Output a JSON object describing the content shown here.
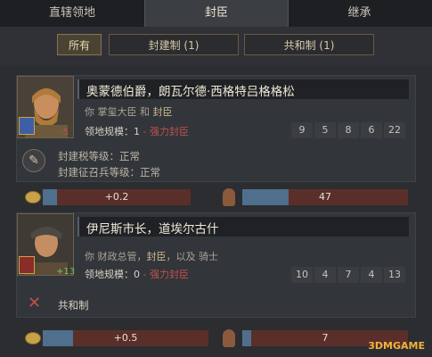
{
  "tabs": [
    {
      "label": "直辖领地"
    },
    {
      "label": "封臣"
    },
    {
      "label": "继承"
    }
  ],
  "filters": [
    {
      "label": "所有"
    },
    {
      "label": "封建制 (1)"
    },
    {
      "label": "共和制 (1)"
    }
  ],
  "vassals": [
    {
      "name": "奥蒙德伯爵，朗瓦尔德·西格特吕格格松",
      "opinion": "-5",
      "role_prefix": "你 掌玺大臣 和 ",
      "role_link": "封臣",
      "domain_label": "领地规模：",
      "domain_value": "1",
      "domain_note": "- 强力封臣",
      "stats": [
        "9",
        "5",
        "8",
        "6",
        "22"
      ],
      "tax_line": "封建税等级：正常",
      "levy_line": "封建征召兵等级：正常",
      "tax_value": "+0.2",
      "levy_value": "47"
    },
    {
      "name": "伊尼斯市长，道埃尔古什",
      "opinion": "+13",
      "role_prefix": "你 财政总管，",
      "role_link": "封臣",
      "role_suffix": "，以及 骑士",
      "domain_label": "领地规模：",
      "domain_value": "0",
      "domain_note": "- 强力封臣",
      "stats": [
        "10",
        "4",
        "7",
        "4",
        "13"
      ],
      "gov_label": "共和制",
      "tax_value": "+0.5",
      "levy_value": "7"
    }
  ],
  "watermark": "3DMGAME"
}
